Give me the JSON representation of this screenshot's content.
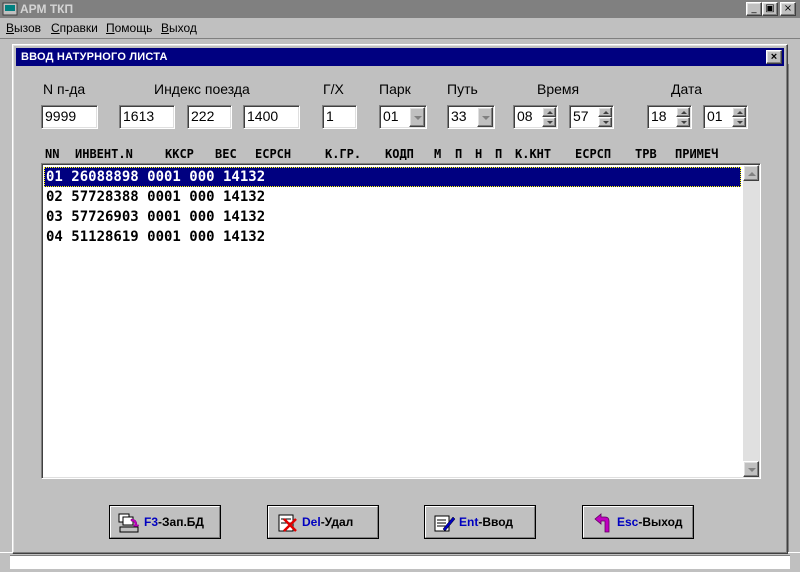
{
  "app": {
    "title": "АРМ ТКП",
    "menu": [
      {
        "hot": "В",
        "rest": "ызов"
      },
      {
        "hot": "С",
        "rest": "правки"
      },
      {
        "hot": "П",
        "rest": "омощь"
      },
      {
        "hot": "В",
        "rest": "ыход"
      }
    ],
    "window_buttons": [
      "_",
      "▣",
      "×"
    ]
  },
  "dialog": {
    "title": "ВВОД НАТУРНОГО ЛИСТА",
    "close": "×",
    "labels": {
      "n_pda": "N п-да",
      "train_index": "Индекс поезда",
      "gx": "Г/Х",
      "park": "Парк",
      "track": "Путь",
      "time": "Время",
      "date": "Дата"
    },
    "fields": {
      "n_pda": "9999",
      "index1": "1613",
      "index2": "222",
      "index3": "1400",
      "gx": "1",
      "park": "01",
      "track": "33",
      "hour": "08",
      "minute": "57",
      "day": "18",
      "month": "01"
    },
    "columns": [
      "NN",
      "ИНВЕНТ.N",
      "ККСР",
      "ВЕС",
      "ЕСРСН",
      "К.ГР.",
      "КОДП",
      "М",
      "П",
      "Н",
      "П",
      "К.КНТ",
      "ЕСРСП",
      "ТРВ",
      "ПРИМЕЧ"
    ],
    "rows": [
      "01 26088898 0001 000 14132",
      "02 57728388 0001 000 14132",
      "03 57726903 0001 000 14132",
      "04 51128619 0001 000 14132"
    ],
    "selected_row": 0,
    "buttons": [
      {
        "key": "F3",
        "label": "-Зап.БД"
      },
      {
        "key": "Del",
        "label": "-Удал"
      },
      {
        "key": "Ent",
        "label": "-Ввод"
      },
      {
        "key": "Esc",
        "label": "-Выход"
      }
    ]
  }
}
